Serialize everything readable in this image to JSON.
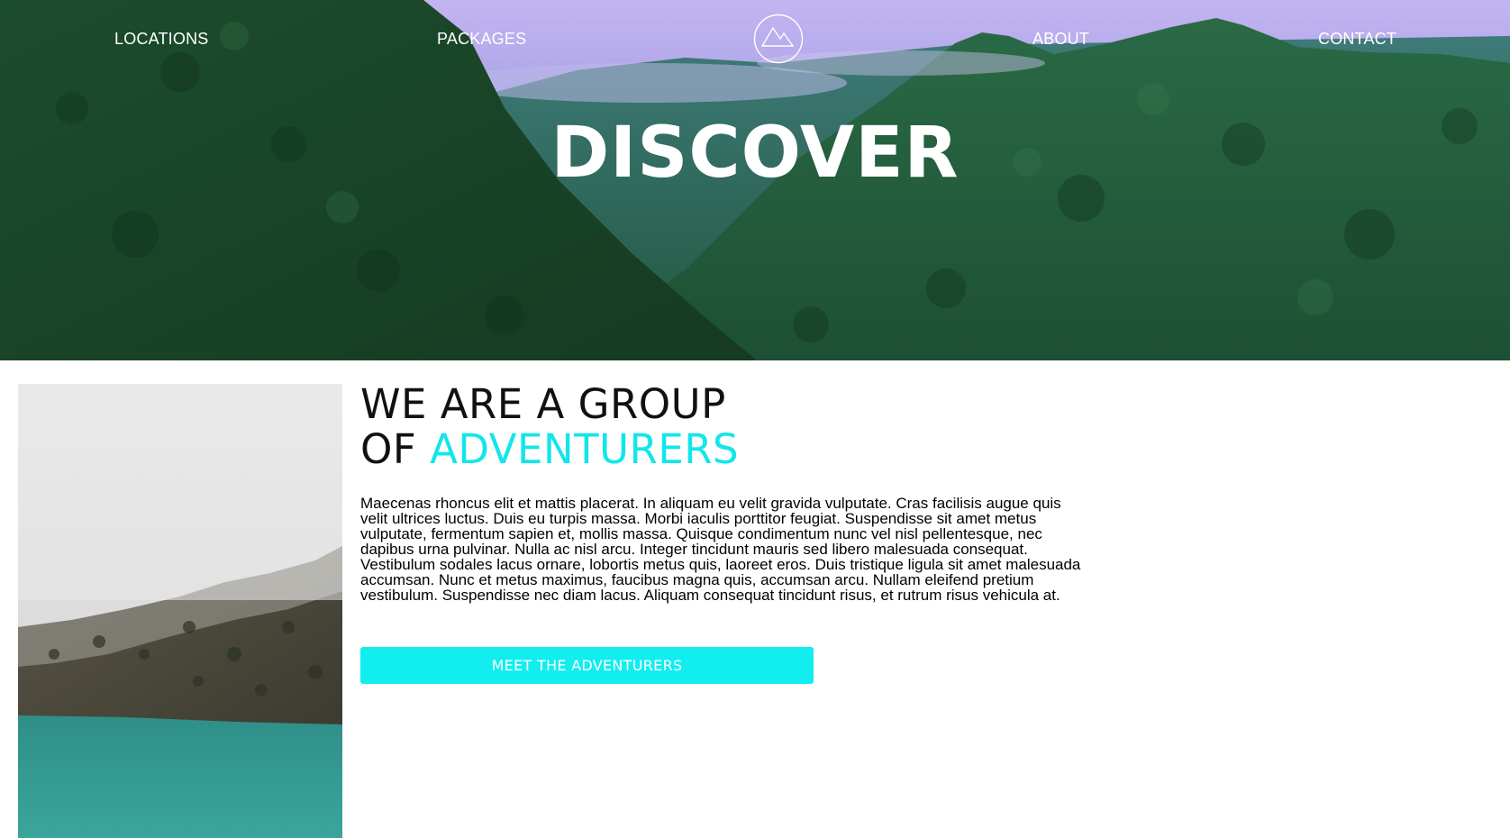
{
  "nav": {
    "links": [
      "LOCATIONS",
      "PACKAGES",
      "ABOUT",
      "CONTACT"
    ],
    "logo_icon": "mountain-logo-icon"
  },
  "hero": {
    "title": "DISCOVER"
  },
  "intro": {
    "headline_line1": "WE ARE A GROUP",
    "headline_line2_prefix": "OF ",
    "headline_line2_accent": "ADVENTURERS",
    "body": "Maecenas rhoncus elit et mattis placerat. In aliquam eu velit gravida vulputate. Cras facilisis augue quis velit ultrices luctus. Duis eu turpis massa. Morbi iaculis porttitor feugiat. Suspendisse sit amet metus vulputate, fermentum sapien et, mollis massa. Quisque condimentum nunc vel nisl pellentesque, nec dapibus urna pulvinar. Nulla ac nisl arcu. Integer tincidunt mauris sed libero malesuada consequat. Vestibulum sodales lacus ornare, lobortis metus quis, laoreet eros. Duis tristique ligula sit amet malesuada accumsan. Nunc et metus maximus, faucibus magna quis, accumsan arcu. Nullam eleifend pretium vestibulum. Suspendisse nec diam lacus. Aliquam consequat tincidunt risus, et rutrum risus vehicula at.",
    "cta_label": "MEET THE ADVENTURERS"
  },
  "colors": {
    "accent": "#12e6ea",
    "button": "#12eef0",
    "text": "#000000"
  }
}
